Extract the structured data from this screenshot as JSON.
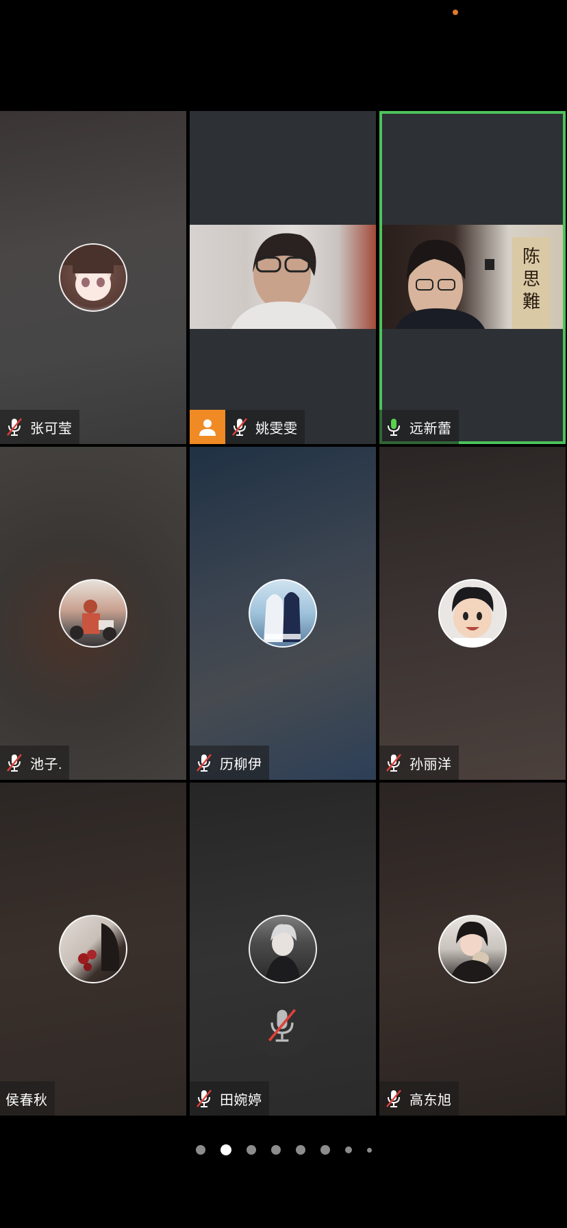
{
  "participants": [
    {
      "name": "张可莹",
      "mic": "muted",
      "mode": "avatar",
      "avatar": "anime-girl-avatar"
    },
    {
      "name": "姚雯雯",
      "mic": "muted",
      "mode": "video",
      "badge": "user-icon"
    },
    {
      "name": "远新蕾",
      "mic": "active",
      "mode": "video",
      "speaking": true
    },
    {
      "name": "池子.",
      "mic": "muted",
      "mode": "avatar",
      "avatar": "photo-avatar"
    },
    {
      "name": "历柳伊",
      "mic": "muted",
      "mode": "avatar",
      "avatar": "anime-couple-avatar"
    },
    {
      "name": "孙丽洋",
      "mic": "muted",
      "mode": "avatar",
      "avatar": "cartoon-boy-avatar"
    },
    {
      "name": "侯春秋",
      "mic": "none",
      "mode": "avatar",
      "avatar": "roses-photo-avatar"
    },
    {
      "name": "田婉婷",
      "mic": "muted",
      "mode": "avatar",
      "avatar": "anime-boy-avatar"
    },
    {
      "name": "高东旭",
      "mic": "muted",
      "mode": "avatar",
      "avatar": "girl-photo-avatar"
    }
  ],
  "pager": {
    "total": 8,
    "current": 2
  },
  "colors": {
    "speaking_border": "#4cc35a",
    "mic_active": "#58d24b",
    "mute_slash": "#e0403a",
    "badge_orange": "#f08a24"
  }
}
